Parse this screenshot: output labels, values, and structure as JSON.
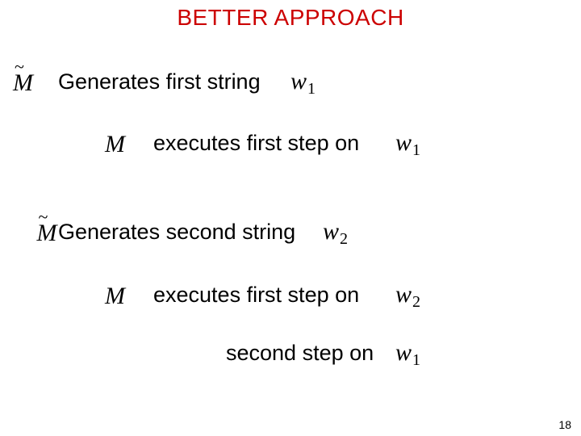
{
  "title": "BETTER APPROACH",
  "symbols": {
    "M_tilde": "M",
    "tilde": "~",
    "M": "M",
    "w": "w",
    "sub1": "1",
    "sub2": "2"
  },
  "lines": {
    "gen_first": "Generates first string",
    "exec_first_on": "executes first step on",
    "gen_second": "Generates second string",
    "exec_first_on_2": "executes first step on",
    "second_step_on": "second step on"
  },
  "page_number": "18"
}
